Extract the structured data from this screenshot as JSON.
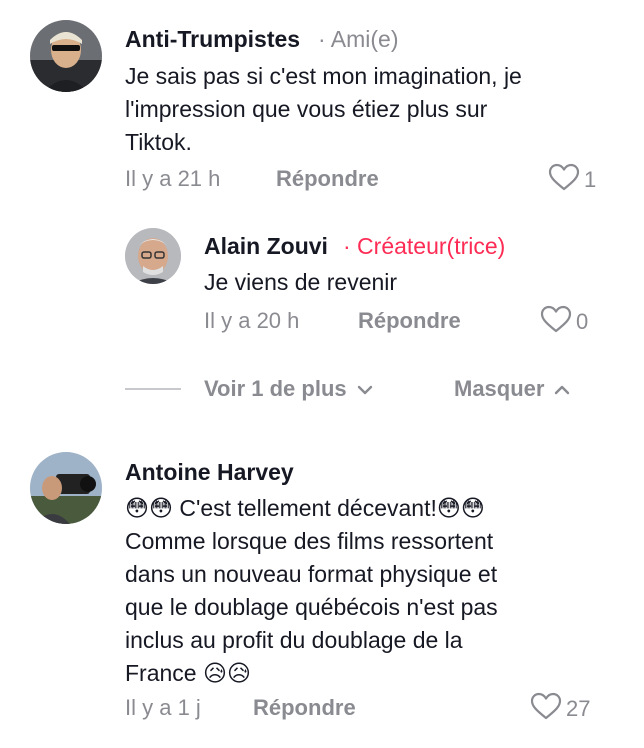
{
  "comments": [
    {
      "author": "Anti-Trumpistes",
      "badge": "· Ami(e)",
      "badge_color": "#8a8b91",
      "text_lines": [
        "Je sais pas si c'est mon imagination, je",
        "l'impression que vous étiez plus sur",
        "Tiktok."
      ],
      "time": "Il y a 21 h",
      "reply_label": "Répondre",
      "likes": "1"
    },
    {
      "author": "Antoine Harvey",
      "text_lines": [
        "😳😳 C'est tellement décevant!😳😳",
        "Comme lorsque des films ressortent",
        "dans un nouveau format physique et",
        "que le doublage québécois n'est pas",
        "inclus au profit du doublage de la",
        "France 😥😥"
      ],
      "time": "Il y a 1 j",
      "reply_label": "Répondre",
      "likes": "27"
    }
  ],
  "reply": {
    "author": "Alain Zouvi",
    "badge": "· Créateur(trice)",
    "badge_color": "#fe2c55",
    "text": "Je viens de revenir",
    "time": "Il y a 20 h",
    "reply_label": "Répondre",
    "likes": "0"
  },
  "thread_controls": {
    "more_label": "Voir 1 de plus",
    "hide_label": "Masquer"
  }
}
